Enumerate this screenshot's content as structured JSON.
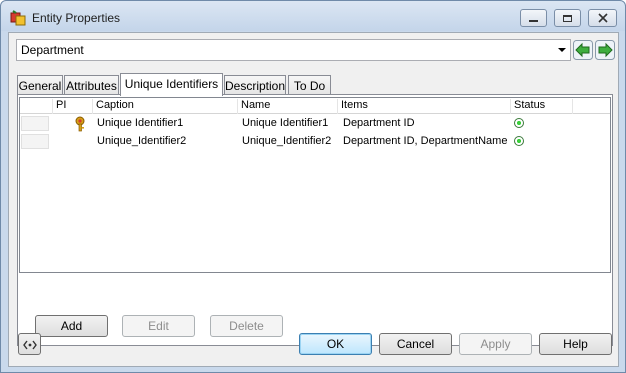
{
  "window": {
    "title": "Entity Properties"
  },
  "entity_select": {
    "value": "Department"
  },
  "tabs": [
    {
      "label": "General"
    },
    {
      "label": "Attributes"
    },
    {
      "label": "Unique Identifiers"
    },
    {
      "label": "Description"
    },
    {
      "label": "To Do"
    }
  ],
  "grid": {
    "columns": [
      "PI",
      "Caption",
      "Name",
      "Items",
      "Status"
    ],
    "rows": [
      {
        "caption": "Unique Identifier1",
        "name": "Unique Identifier1",
        "items": "Department ID",
        "pi_icon": "key-icon",
        "status": "ok"
      },
      {
        "caption": "Unique_Identifier2",
        "name": "Unique_Identifier2",
        "items": "Department ID, DepartmentName",
        "pi_icon": "",
        "status": "ok"
      }
    ]
  },
  "panel_buttons": {
    "add": "Add",
    "edit": "Edit",
    "delete": "Delete"
  },
  "footer_buttons": {
    "ok": "OK",
    "cancel": "Cancel",
    "apply": "Apply",
    "help": "Help"
  },
  "colors": {
    "accent": "#3c7fb1",
    "status_ok": "#3cd03c",
    "key_gold": "#d4a017",
    "nav_green": "#3fae3f"
  }
}
